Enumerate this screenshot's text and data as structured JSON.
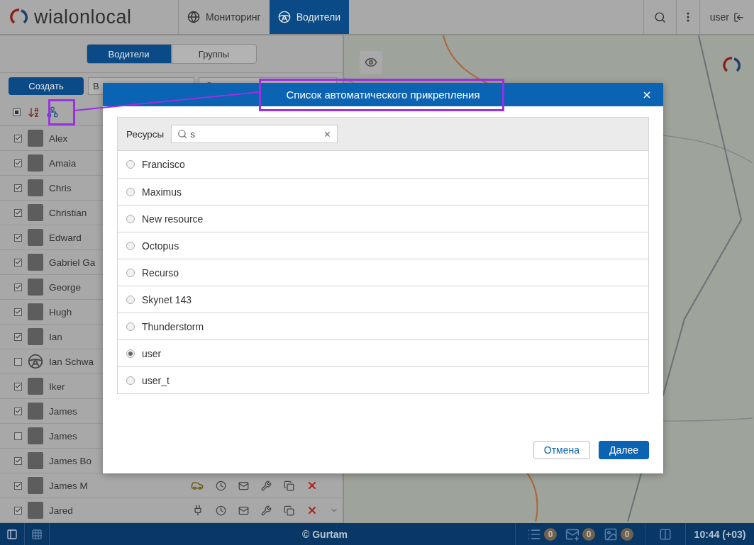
{
  "header": {
    "logo": "wialonlocal",
    "nav": [
      {
        "label": "Мониторинг",
        "kind": "globe",
        "selected": false
      },
      {
        "label": "Водители",
        "kind": "wheel",
        "selected": true
      }
    ],
    "user": "user"
  },
  "left_panel": {
    "tabs": [
      {
        "label": "Водители",
        "selected": true
      },
      {
        "label": "Группы",
        "selected": false
      }
    ],
    "create_button": "Создать",
    "filter_value": "В",
    "select_all": {
      "indeterminate": true
    },
    "drivers": [
      {
        "name": "Alex",
        "checked": true,
        "has_photo": true
      },
      {
        "name": "Amaia",
        "checked": true,
        "has_photo": true
      },
      {
        "name": "Chris",
        "checked": true,
        "has_photo": true
      },
      {
        "name": "Christian",
        "checked": true,
        "has_photo": true
      },
      {
        "name": "Edward",
        "checked": true,
        "has_photo": true
      },
      {
        "name": "Gabriel Ga",
        "checked": true,
        "has_photo": true
      },
      {
        "name": "George",
        "checked": true,
        "has_photo": true
      },
      {
        "name": "Hugh",
        "checked": true,
        "has_photo": true
      },
      {
        "name": "Ian",
        "checked": true,
        "has_photo": true
      },
      {
        "name": "Ian Schwa",
        "checked": false,
        "has_photo": false
      },
      {
        "name": "Iker",
        "checked": true,
        "has_photo": true
      },
      {
        "name": "James",
        "checked": true,
        "has_photo": true
      },
      {
        "name": "James",
        "checked": false,
        "has_photo": true
      },
      {
        "name": "James Bo",
        "checked": true,
        "has_photo": true
      },
      {
        "name": "James M",
        "checked": true,
        "has_photo": true,
        "kind": "car"
      },
      {
        "name": "Jared",
        "checked": true,
        "has_photo": true,
        "kind": "plug"
      }
    ]
  },
  "modal": {
    "title": "Список автоматического прикрепления",
    "search_label": "Ресурсы",
    "search_value": "s",
    "resources": [
      {
        "name": "Francisco",
        "selected": false
      },
      {
        "name": "Maximus",
        "selected": false
      },
      {
        "name": "New resource",
        "selected": false
      },
      {
        "name": "Octopus",
        "selected": false
      },
      {
        "name": "Recurso",
        "selected": false
      },
      {
        "name": "Skynet 143",
        "selected": false
      },
      {
        "name": "Thunderstorm",
        "selected": false
      },
      {
        "name": "user",
        "selected": true
      },
      {
        "name": "user_t",
        "selected": false
      }
    ],
    "buttons": [
      {
        "label": "Отмена",
        "kind": "secondary"
      },
      {
        "label": "Далее",
        "kind": "primary"
      }
    ]
  },
  "status_bar": {
    "copyright": "© Gurtam",
    "counters": [
      {
        "kind": "list",
        "count": "0"
      },
      {
        "kind": "mail",
        "count": "0"
      },
      {
        "kind": "image",
        "count": "0"
      }
    ],
    "time": "10:44 (+03)"
  }
}
